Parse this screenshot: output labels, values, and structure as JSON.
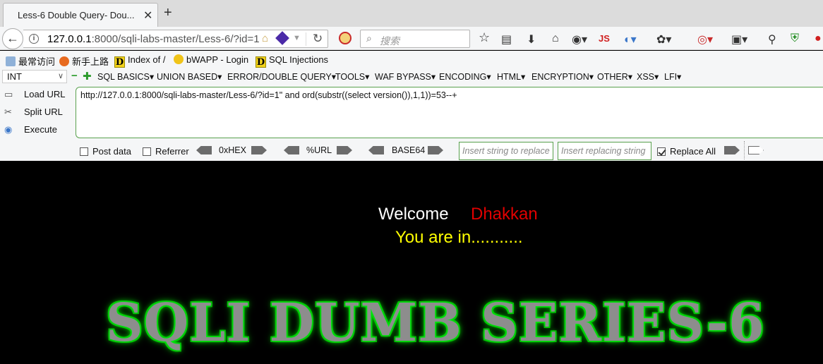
{
  "tab": {
    "title": "Less-6 Double Query- Dou...",
    "close": "✕",
    "new": "+"
  },
  "nav": {
    "back": "←",
    "url_host": "127.0.0.1",
    "url_path": ":8000/sqli-labs-master/Less-6/?id=1",
    "search_placeholder": "搜索",
    "js_label": "JS"
  },
  "bookmarks": [
    {
      "label": "最常访问"
    },
    {
      "label": "新手上路"
    },
    {
      "label": "Index of /"
    },
    {
      "label": "bWAPP - Login"
    },
    {
      "label": "SQL Injections"
    }
  ],
  "hackbar": {
    "select_value": "INT",
    "menu": [
      "SQL BASICS▾",
      "UNION BASED▾",
      "ERROR/DOUBLE QUERY▾",
      "TOOLS▾",
      "WAF BYPASS▾",
      "ENCODING▾",
      "HTML▾",
      "ENCRYPTION▾",
      "OTHER▾",
      "XSS▾",
      "LFI▾"
    ],
    "load_url": "Load URL",
    "split_url": "Split URL",
    "execute": "Execute",
    "query": "http://127.0.0.1:8000/sqli-labs-master/Less-6/?id=1\" and ord(substr((select version()),1,1))=53--+",
    "post_data": "Post data",
    "referrer": "Referrer",
    "hex": "0xHEX",
    "url_enc": "%URL",
    "base64": "BASE64",
    "insert_placeholder": "Insert string to replace",
    "replacing_placeholder": "Insert replacing string",
    "replace_all": "Replace All",
    "replace_all_checked": true
  },
  "page": {
    "welcome": "Welcome",
    "name": "Dhakkan",
    "status": "You are in...........",
    "banner": "SQLI DUMB SERIES-6"
  },
  "colors": {
    "name": "#e00000",
    "status": "#ffff00",
    "banner_glow": "#00ff22",
    "hackbar_border": "#59a14e"
  }
}
